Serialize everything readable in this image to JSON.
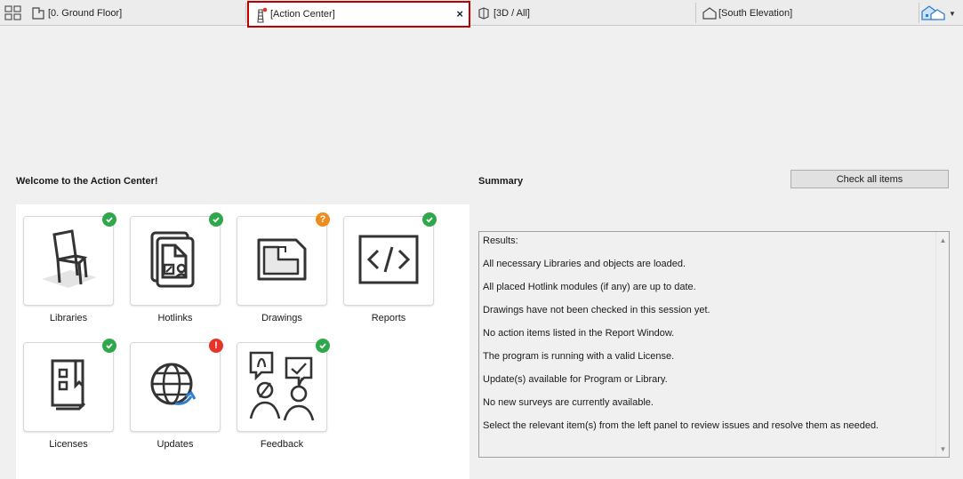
{
  "tabs": [
    {
      "label": "[0. Ground Floor]",
      "icon": "floor-plan-icon"
    },
    {
      "label": "[Action Center]",
      "icon": "lighthouse-icon",
      "active": true
    },
    {
      "label": "[3D / All]",
      "icon": "3d-box-icon"
    },
    {
      "label": "[South Elevation]",
      "icon": "elevation-house-icon"
    }
  ],
  "tab_close": "×",
  "welcome_title": "Welcome to the Action Center!",
  "summary_title": "Summary",
  "check_all_label": "Check all items",
  "tiles": [
    {
      "label": "Libraries",
      "status": "ok",
      "icon": "chair-icon"
    },
    {
      "label": "Hotlinks",
      "status": "ok",
      "icon": "hotlink-documents-icon"
    },
    {
      "label": "Drawings",
      "status": "warn",
      "status_mark": "?",
      "icon": "drawing-folder-icon"
    },
    {
      "label": "Reports",
      "status": "ok",
      "icon": "code-brackets-icon"
    },
    {
      "label": "Licenses",
      "status": "ok",
      "icon": "license-book-icon"
    },
    {
      "label": "Updates",
      "status": "err",
      "status_mark": "!",
      "icon": "globe-update-icon"
    },
    {
      "label": "Feedback",
      "status": "ok",
      "icon": "feedback-people-icon"
    }
  ],
  "results": [
    "Results:",
    "All necessary Libraries and objects are loaded.",
    "All placed Hotlink modules (if any) are up to date.",
    "Drawings have not been checked in this session yet.",
    "No action items listed in the Report Window.",
    "The program is running with a valid License.",
    "Update(s) available for Program or Library.",
    "No new surveys are currently available.",
    "Select the relevant item(s) from the left panel to review issues and resolve them as needed."
  ],
  "colors": {
    "active_tab_border": "#c00000",
    "ok": "#2ea84a",
    "warn": "#f08c1c",
    "err": "#e5352a"
  }
}
